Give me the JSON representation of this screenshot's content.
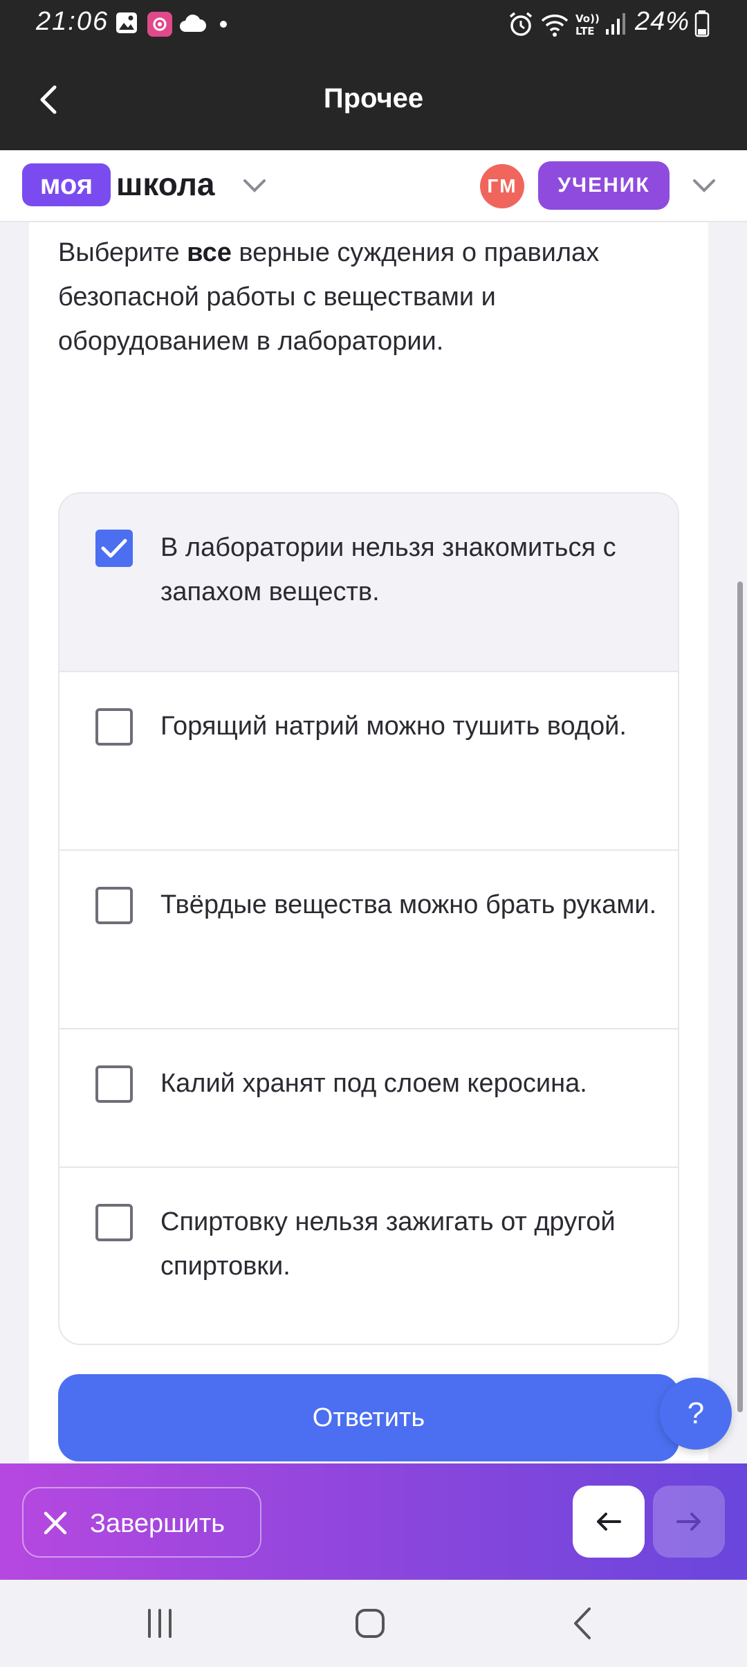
{
  "status_bar": {
    "time": "21:06",
    "battery": "24%",
    "icons": [
      "gallery-icon",
      "app-notification-icon",
      "cloud-icon",
      "dot-icon",
      "alarm-icon",
      "wifi-icon",
      "volte-icon",
      "signal-icon",
      "battery-icon"
    ]
  },
  "app_bar": {
    "title": "Прочее",
    "back_icon": "chevron-left-icon"
  },
  "brand": {
    "logo_box": "моя",
    "logo_text": "школа",
    "avatar_initials": "ГМ",
    "role": "УЧЕНИК"
  },
  "question": {
    "prefix": "Выберите ",
    "emphasis": "все",
    "suffix": " верные суждения о правилах безопасной работы с веществами и оборудованием в лаборатории."
  },
  "options": [
    {
      "text": "В лаборатории нельзя знакомиться с запахом веществ.",
      "checked": true
    },
    {
      "text": "Горящий натрий можно тушить водой.",
      "checked": false
    },
    {
      "text": "Твёрдые вещества можно брать руками.",
      "checked": false
    },
    {
      "text": "Калий хранят под слоем керосина.",
      "checked": false
    },
    {
      "text": "Спиртовку нельзя зажигать от другой спиртовки.",
      "checked": false
    }
  ],
  "submit_label": "Ответить",
  "help_label": "?",
  "bottom_bar": {
    "finish_label": "Завершить"
  },
  "colors": {
    "accent": "#4b6ff0",
    "brand_purple": "#7a4cf0",
    "avatar": "#f0665c",
    "dark_header": "#262626"
  }
}
